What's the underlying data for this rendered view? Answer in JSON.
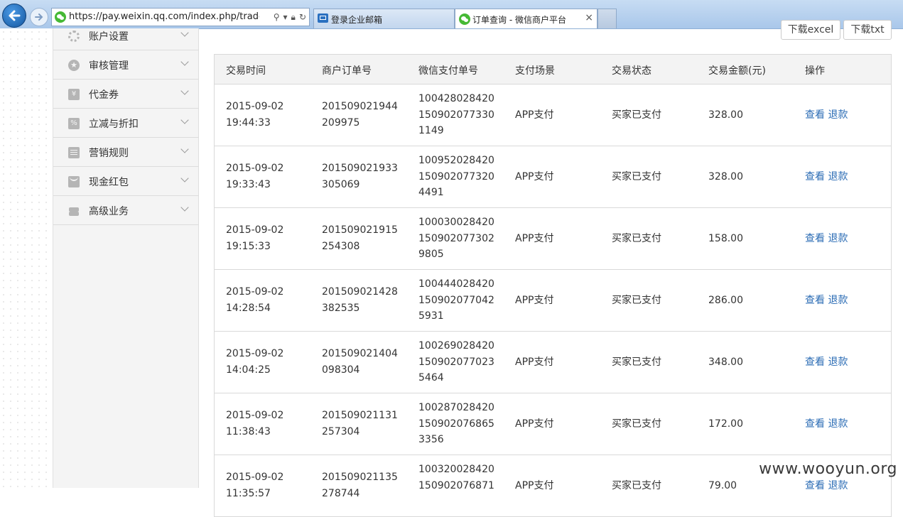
{
  "browser": {
    "url": "https://pay.weixin.qq.com/index.php/trade/sea",
    "tabs": [
      {
        "label": "登录企业邮箱",
        "icon": "mail-icon"
      },
      {
        "label": "订单查询 - 微信商户平台",
        "icon": "wechat-icon",
        "close": "×"
      }
    ]
  },
  "toolbar": {
    "download_excel": "下载excel",
    "download_txt": "下载txt"
  },
  "sidebar": {
    "items": [
      {
        "label": "账户设置",
        "icon": "gear-icon"
      },
      {
        "label": "审核管理",
        "icon": "star-icon"
      },
      {
        "label": "代金券",
        "icon": "coupon-icon"
      },
      {
        "label": "立减与折扣",
        "icon": "discount-icon"
      },
      {
        "label": "营销规则",
        "icon": "rules-icon"
      },
      {
        "label": "现金红包",
        "icon": "envelope-icon"
      },
      {
        "label": "高级业务",
        "icon": "layers-icon"
      }
    ]
  },
  "table": {
    "headers": [
      "交易时间",
      "商户订单号",
      "微信支付单号",
      "支付场景",
      "交易状态",
      "交易金额(元)",
      "操作"
    ],
    "rows": [
      {
        "time": "2015-09-02 19:44:33",
        "merchant_order": "201509021944209975",
        "wx_order": "1004280284201509020773301149",
        "scene": "APP支付",
        "status": "买家已支付",
        "amount": "328.00",
        "view": "查看",
        "refund": "退款"
      },
      {
        "time": "2015-09-02 19:33:43",
        "merchant_order": "201509021933305069",
        "wx_order": "1009520284201509020773204491",
        "scene": "APP支付",
        "status": "买家已支付",
        "amount": "328.00",
        "view": "查看",
        "refund": "退款"
      },
      {
        "time": "2015-09-02 19:15:33",
        "merchant_order": "201509021915254308",
        "wx_order": "1000300284201509020773029805",
        "scene": "APP支付",
        "status": "买家已支付",
        "amount": "158.00",
        "view": "查看",
        "refund": "退款"
      },
      {
        "time": "2015-09-02 14:28:54",
        "merchant_order": "201509021428382535",
        "wx_order": "1004440284201509020770425931",
        "scene": "APP支付",
        "status": "买家已支付",
        "amount": "286.00",
        "view": "查看",
        "refund": "退款"
      },
      {
        "time": "2015-09-02 14:04:25",
        "merchant_order": "201509021404098304",
        "wx_order": "1002690284201509020770235464",
        "scene": "APP支付",
        "status": "买家已支付",
        "amount": "348.00",
        "view": "查看",
        "refund": "退款"
      },
      {
        "time": "2015-09-02 11:38:43",
        "merchant_order": "201509021131257304",
        "wx_order": "1002870284201509020768653356",
        "scene": "APP支付",
        "status": "买家已支付",
        "amount": "172.00",
        "view": "查看",
        "refund": "退款"
      },
      {
        "time": "2015-09-02 11:35:57",
        "merchant_order": "201509021135278744",
        "wx_order": "100320028420150902076871",
        "scene": "APP支付",
        "status": "买家已支付",
        "amount": "79.00",
        "view": "查看",
        "refund": "退款"
      }
    ]
  },
  "watermark": "www.wooyun.org"
}
